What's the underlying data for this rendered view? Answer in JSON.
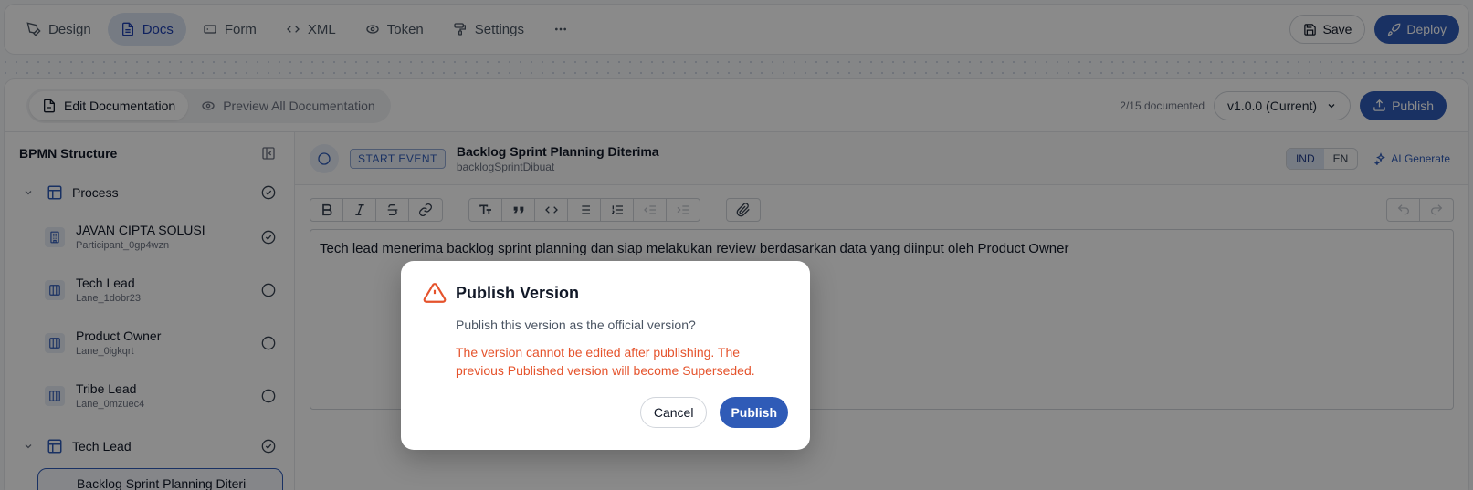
{
  "tabs": [
    {
      "label": "Design",
      "icon": "pen-tool-icon"
    },
    {
      "label": "Docs",
      "icon": "document-icon"
    },
    {
      "label": "Form",
      "icon": "form-icon"
    },
    {
      "label": "XML",
      "icon": "code-icon"
    },
    {
      "label": "Token",
      "icon": "eye-icon"
    },
    {
      "label": "Settings",
      "icon": "paint-roller-icon"
    }
  ],
  "topbar": {
    "save_label": "Save",
    "deploy_label": "Deploy",
    "more_icon": "more-horizontal-icon"
  },
  "doc_modes": {
    "edit": "Edit Documentation",
    "preview": "Preview All Documentation"
  },
  "header": {
    "doc_count": "2/15 documented",
    "version": "v1.0.0 (Current)",
    "publish_label": "Publish"
  },
  "sidebar": {
    "title": "BPMN Structure",
    "groups": [
      {
        "label": "Process"
      },
      {
        "label": "Tech Lead"
      }
    ],
    "items": [
      {
        "title": "JAVAN CIPTA SOLUSI",
        "sub": "Participant_0gp4wzn",
        "status": "done"
      },
      {
        "title": "Tech Lead",
        "sub": "Lane_1dobr23",
        "status": "pending"
      },
      {
        "title": "Product Owner",
        "sub": "Lane_0igkqrt",
        "status": "pending"
      },
      {
        "title": "Tribe Lead",
        "sub": "Lane_0mzuec4",
        "status": "pending"
      }
    ],
    "selected_partial": "Backlog Sprint Planning Diteri"
  },
  "event": {
    "badge": "START EVENT",
    "title": "Backlog Sprint Planning Diterima",
    "id": "backlogSprintDibuat",
    "lang": [
      "IND",
      "EN"
    ],
    "lang_active": "IND",
    "ai_generate": "AI Generate"
  },
  "editor": {
    "text": "Tech lead menerima backlog sprint planning dan siap melakukan review berdasarkan data yang diinput oleh Product Owner"
  },
  "modal": {
    "title": "Publish Version",
    "question": "Publish this version as the official version?",
    "warning": "The version cannot be edited after publishing. The previous Published version will become Superseded.",
    "cancel_label": "Cancel",
    "publish_label": "Publish"
  },
  "colors": {
    "primary": "#2f5bb7",
    "warning": "#e5532c",
    "active_tab_bg": "#dbe4f3"
  }
}
